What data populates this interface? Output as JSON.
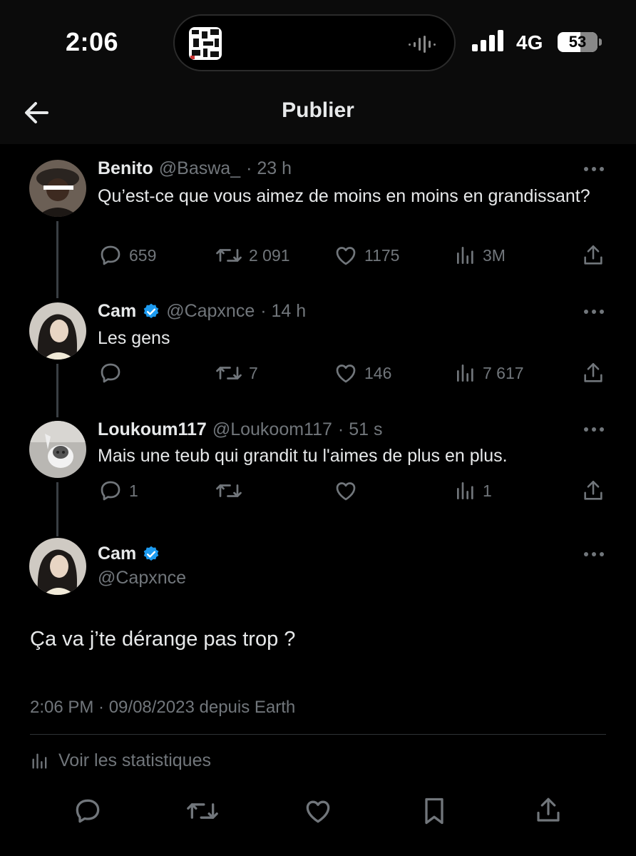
{
  "status_bar": {
    "time": "2:06",
    "network": "4G",
    "battery": "53"
  },
  "nav": {
    "title": "Publier",
    "back_icon": "arrow-left-icon"
  },
  "tweets": [
    {
      "name": "Benito",
      "handle": "@Baswa_",
      "time": "· 23 h",
      "verified": false,
      "text": "Qu’est-ce que vous aimez de moins en moins en grandissant?",
      "replies": "659",
      "retweets": "2 091",
      "likes": "1175",
      "views": "3M"
    },
    {
      "name": "Cam",
      "handle": "@Capxnce",
      "time": "· 14 h",
      "verified": true,
      "text": "Les gens",
      "replies": "",
      "retweets": "7",
      "likes": "146",
      "views": "7 617"
    },
    {
      "name": "Loukoum117",
      "handle": "@Loukoom117",
      "time": "· 51 s",
      "verified": false,
      "text": "Mais une teub qui grandit tu l'aimes de plus en plus.",
      "replies": "1",
      "retweets": "",
      "likes": "",
      "views": "1"
    }
  ],
  "main_tweet": {
    "name": "Cam",
    "handle": "@Capxnce",
    "verified": true,
    "text": "Ça va j’te dérange pas trop ?",
    "meta": "2:06 PM · 09/08/2023 depuis Earth",
    "stats_label": "Voir les statistiques"
  },
  "colors": {
    "background": "#000000",
    "text": "#e7e9ea",
    "muted": "#71767b",
    "verified": "#1d9bf0",
    "divider": "#2f3336"
  }
}
